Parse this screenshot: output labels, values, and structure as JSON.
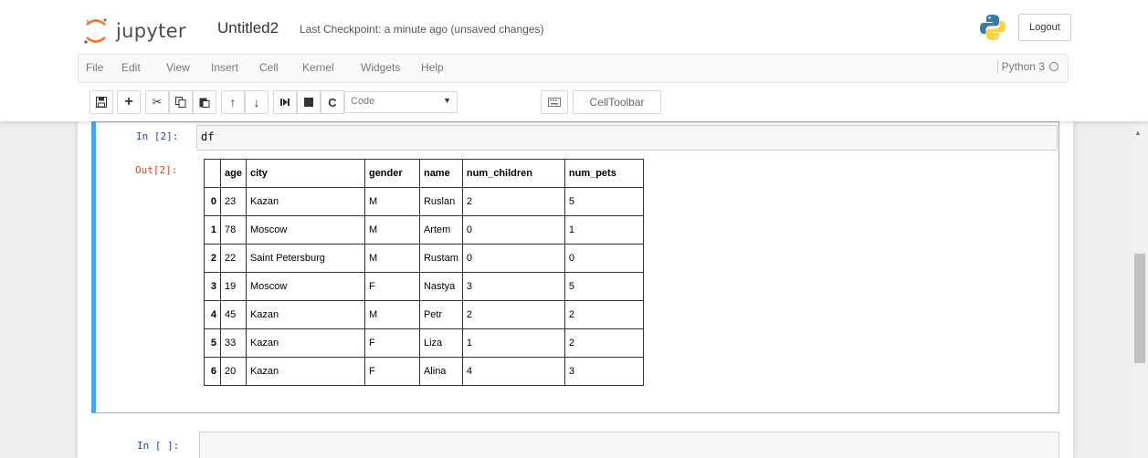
{
  "header": {
    "logo_text": "jupyter",
    "notebook_name": "Untitled2",
    "checkpoint": "Last Checkpoint: a minute ago (unsaved changes)",
    "logout_label": "Logout"
  },
  "menu": {
    "items": [
      "File",
      "Edit",
      "View",
      "Insert",
      "Cell",
      "Kernel",
      "Widgets",
      "Help"
    ],
    "kernel_name": "Python 3"
  },
  "toolbar": {
    "icons": [
      "save-icon",
      "plus-icon",
      "scissors-icon",
      "copy-icon",
      "paste-icon",
      "arrow-up-icon",
      "arrow-down-icon",
      "step-icon",
      "stop-icon",
      "restart-icon"
    ],
    "cell_type": "Code",
    "celltoolbar_label": "CellToolbar"
  },
  "cells": [
    {
      "in_prompt": "In [2]:",
      "source": "df",
      "out_prompt": "Out[2]:",
      "table": {
        "columns": [
          "",
          "age",
          "city",
          "gender",
          "name",
          "num_children",
          "num_pets"
        ],
        "rows": [
          [
            "0",
            "23",
            "Kazan",
            "M",
            "Ruslan",
            "2",
            "5"
          ],
          [
            "1",
            "78",
            "Moscow",
            "M",
            "Artem",
            "0",
            "1"
          ],
          [
            "2",
            "22",
            "Saint Petersburg",
            "M",
            "Rustam",
            "0",
            "0"
          ],
          [
            "3",
            "19",
            "Moscow",
            "F",
            "Nastya",
            "3",
            "5"
          ],
          [
            "4",
            "45",
            "Kazan",
            "M",
            "Petr",
            "2",
            "2"
          ],
          [
            "5",
            "33",
            "Kazan",
            "F",
            "Liza",
            "1",
            "2"
          ],
          [
            "6",
            "20",
            "Kazan",
            "F",
            "Alina",
            "4",
            "3"
          ]
        ]
      }
    },
    {
      "in_prompt": "In [ ]:",
      "source": ""
    }
  ],
  "colors": {
    "selected_cell_border": "#42a5f5",
    "in_prompt": "#303f9f",
    "out_prompt": "#d84315"
  }
}
